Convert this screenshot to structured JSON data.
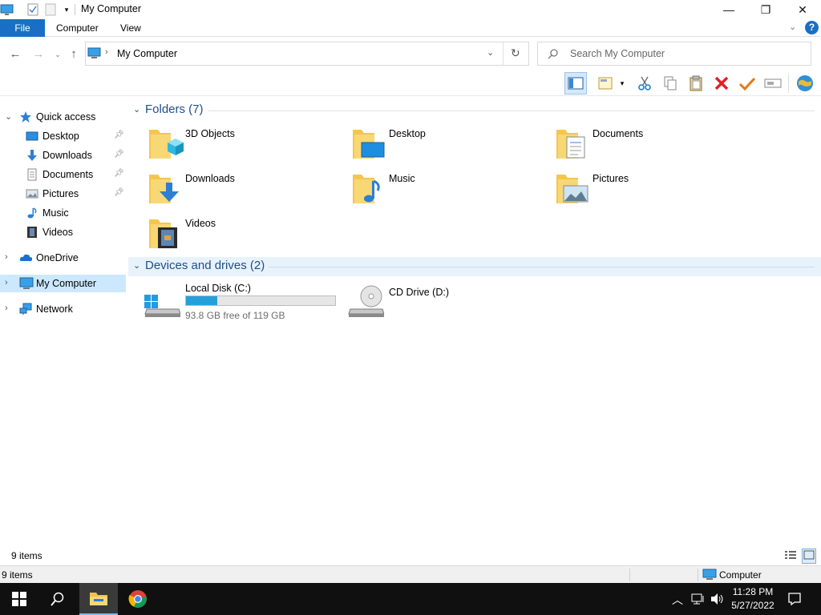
{
  "window": {
    "title": "My Computer",
    "controls": {
      "minimize": "—",
      "restore": "❐",
      "close": "✕"
    }
  },
  "ribbon": {
    "tabs": [
      "File",
      "Computer",
      "View"
    ],
    "help_icon": "?"
  },
  "address": {
    "path_text": "My Computer",
    "search_placeholder": "Search My Computer"
  },
  "nav": {
    "quick_access": "Quick access",
    "quick_items": [
      {
        "label": "Desktop",
        "pinned": true
      },
      {
        "label": "Downloads",
        "pinned": true
      },
      {
        "label": "Documents",
        "pinned": true
      },
      {
        "label": "Pictures",
        "pinned": true
      },
      {
        "label": "Music",
        "pinned": false
      },
      {
        "label": "Videos",
        "pinned": false
      }
    ],
    "onedrive": "OneDrive",
    "my_computer": "My Computer",
    "network": "Network"
  },
  "content": {
    "folders_header": "Folders (7)",
    "folders": [
      "3D Objects",
      "Desktop",
      "Documents",
      "Downloads",
      "Music",
      "Pictures",
      "Videos"
    ],
    "drives_header": "Devices and drives (2)",
    "drives": [
      {
        "name": "Local Disk (C:)",
        "free_text": "93.8 GB free of 119 GB",
        "used_fraction": 0.21
      },
      {
        "name": "CD Drive (D:)"
      }
    ]
  },
  "status": {
    "inner_items": "9 items",
    "outer_items": "9 items",
    "location": "Computer"
  },
  "taskbar": {
    "time": "11:28 PM",
    "date": "5/27/2022"
  },
  "colors": {
    "accent": "#1a6fc4",
    "selection": "#cce8ff",
    "group_header": "#1e4e8c",
    "disk_fill": "#26a0da",
    "folder": "#f4c64d"
  }
}
